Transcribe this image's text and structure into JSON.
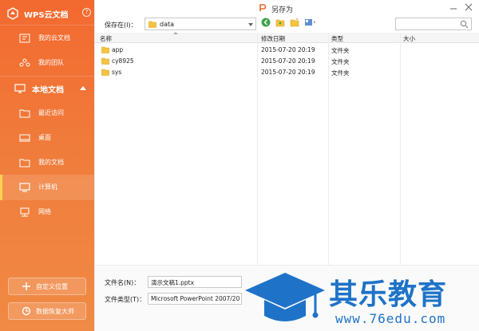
{
  "sidebar": {
    "brand": "WPS云文档",
    "help": "?",
    "cloud_items": [
      {
        "label": "我的云文档",
        "icon": "cloud-docs-icon"
      },
      {
        "label": "我的团队",
        "icon": "team-icon"
      }
    ],
    "local_header": "本地文档",
    "local_items": [
      {
        "label": "最近访问",
        "icon": "recent-folder-icon"
      },
      {
        "label": "桌面",
        "icon": "desktop-icon"
      },
      {
        "label": "我的文档",
        "icon": "my-docs-folder-icon"
      },
      {
        "label": "计算机",
        "icon": "computer-icon",
        "active": true
      },
      {
        "label": "网络",
        "icon": "network-icon"
      }
    ],
    "add_location": "自定义位置",
    "data_recovery": "数据恢复大师"
  },
  "dialog": {
    "title": "另存为",
    "save_in_label": "保存在(I)：",
    "save_in_value": "data",
    "columns": {
      "name": "名称",
      "modified": "修改日期",
      "type": "类型",
      "size": "大小"
    },
    "files": [
      {
        "name": "app",
        "modified": "2015-07-20 20:19",
        "type": "文件夹",
        "size": ""
      },
      {
        "name": "cy8925",
        "modified": "2015-07-20 20:19",
        "type": "文件夹",
        "size": ""
      },
      {
        "name": "sys",
        "modified": "2015-07-20 20:19",
        "type": "文件夹",
        "size": ""
      }
    ],
    "filename_label": "文件名(N)：",
    "filename_value": "演示文稿1.pptx",
    "filetype_label": "文件类型(T)：",
    "filetype_value": "Microsoft PowerPoint 2007/2010"
  },
  "watermark": {
    "title": "其乐教育",
    "url": "www.76edu.com"
  },
  "colors": {
    "sidebar": "#f3692f",
    "brand_blue": "#1e73c8"
  }
}
